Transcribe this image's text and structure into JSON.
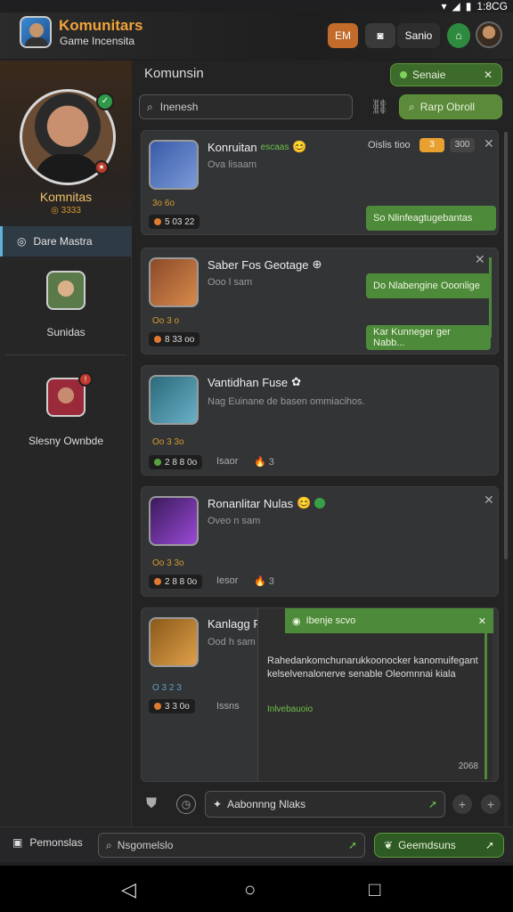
{
  "status_bar": {
    "clock": "1:8CG"
  },
  "header": {
    "title": "Komunitars",
    "subtitle": "Game Incensita",
    "btn1": "EM",
    "btn2": "Sanio"
  },
  "sidebar": {
    "profile_name": "Komnitas",
    "profile_level": "◎ 3333",
    "nav_item": "Dare Mastra",
    "friends": [
      {
        "name": "Sunidas"
      },
      {
        "name": "Slesny Ownbde"
      }
    ]
  },
  "main": {
    "heading": "Komunsin",
    "top_button": "Senaie",
    "search_placeholder": "Inenesh",
    "search_button": "Rarp Obroll",
    "cards": [
      {
        "title": "Konruitan",
        "title_tag": "escaas",
        "sub": "Ova lisaam",
        "level": "3o 6o",
        "pill": "5 03 22",
        "meta": "Oislis tioo",
        "badge": "3",
        "badge2": "300",
        "bubbles": [
          "So Nlinfeagtugebantas"
        ]
      },
      {
        "title": "Saber Fos Geotage",
        "sub": "Ooo l sam",
        "level": "Oo 3 o",
        "pill": "8 33 oo",
        "bubbles": [
          "Do Nlabengine Ooonlige",
          "Kar Kunneger ger Nabb..."
        ]
      },
      {
        "title": "Vantidhan Fuse",
        "sub": "Nag Euinane de basen ommiacihos.",
        "level": "Oo 3 3o",
        "pill": "2 8 8 0o",
        "time": "Isaor",
        "count": "3"
      },
      {
        "title": "Ronanlitar Nulas",
        "sub": "Oveo n sam",
        "level": "Oo 3 3o",
        "pill": "2 8 8 0o",
        "time": "Iesor",
        "count": "3"
      },
      {
        "title": "Kanlagg Rails",
        "sub": "Ood h sam",
        "level": "O 3 2 3",
        "pill": "3 3 0o",
        "time": "Issns",
        "panel_header": "Ibenje scvo",
        "panel_text": "Rahedankomchunarukkoonocker kanomuifegant kelselvenalonerve senable Oleomnnai kiala",
        "panel_link": "Inlvebauoio",
        "panel_num": "2068"
      }
    ],
    "composer_placeholder": "Aabonnng Nlaks"
  },
  "bottom_bar": {
    "left_label": "Pemonslas",
    "search": "Nsgomelslo",
    "right_button": "Geemdsuns"
  },
  "colors": {
    "accent_orange": "#f2a23a",
    "accent_green": "#4d8a3a",
    "bg": "#1f1f21"
  }
}
